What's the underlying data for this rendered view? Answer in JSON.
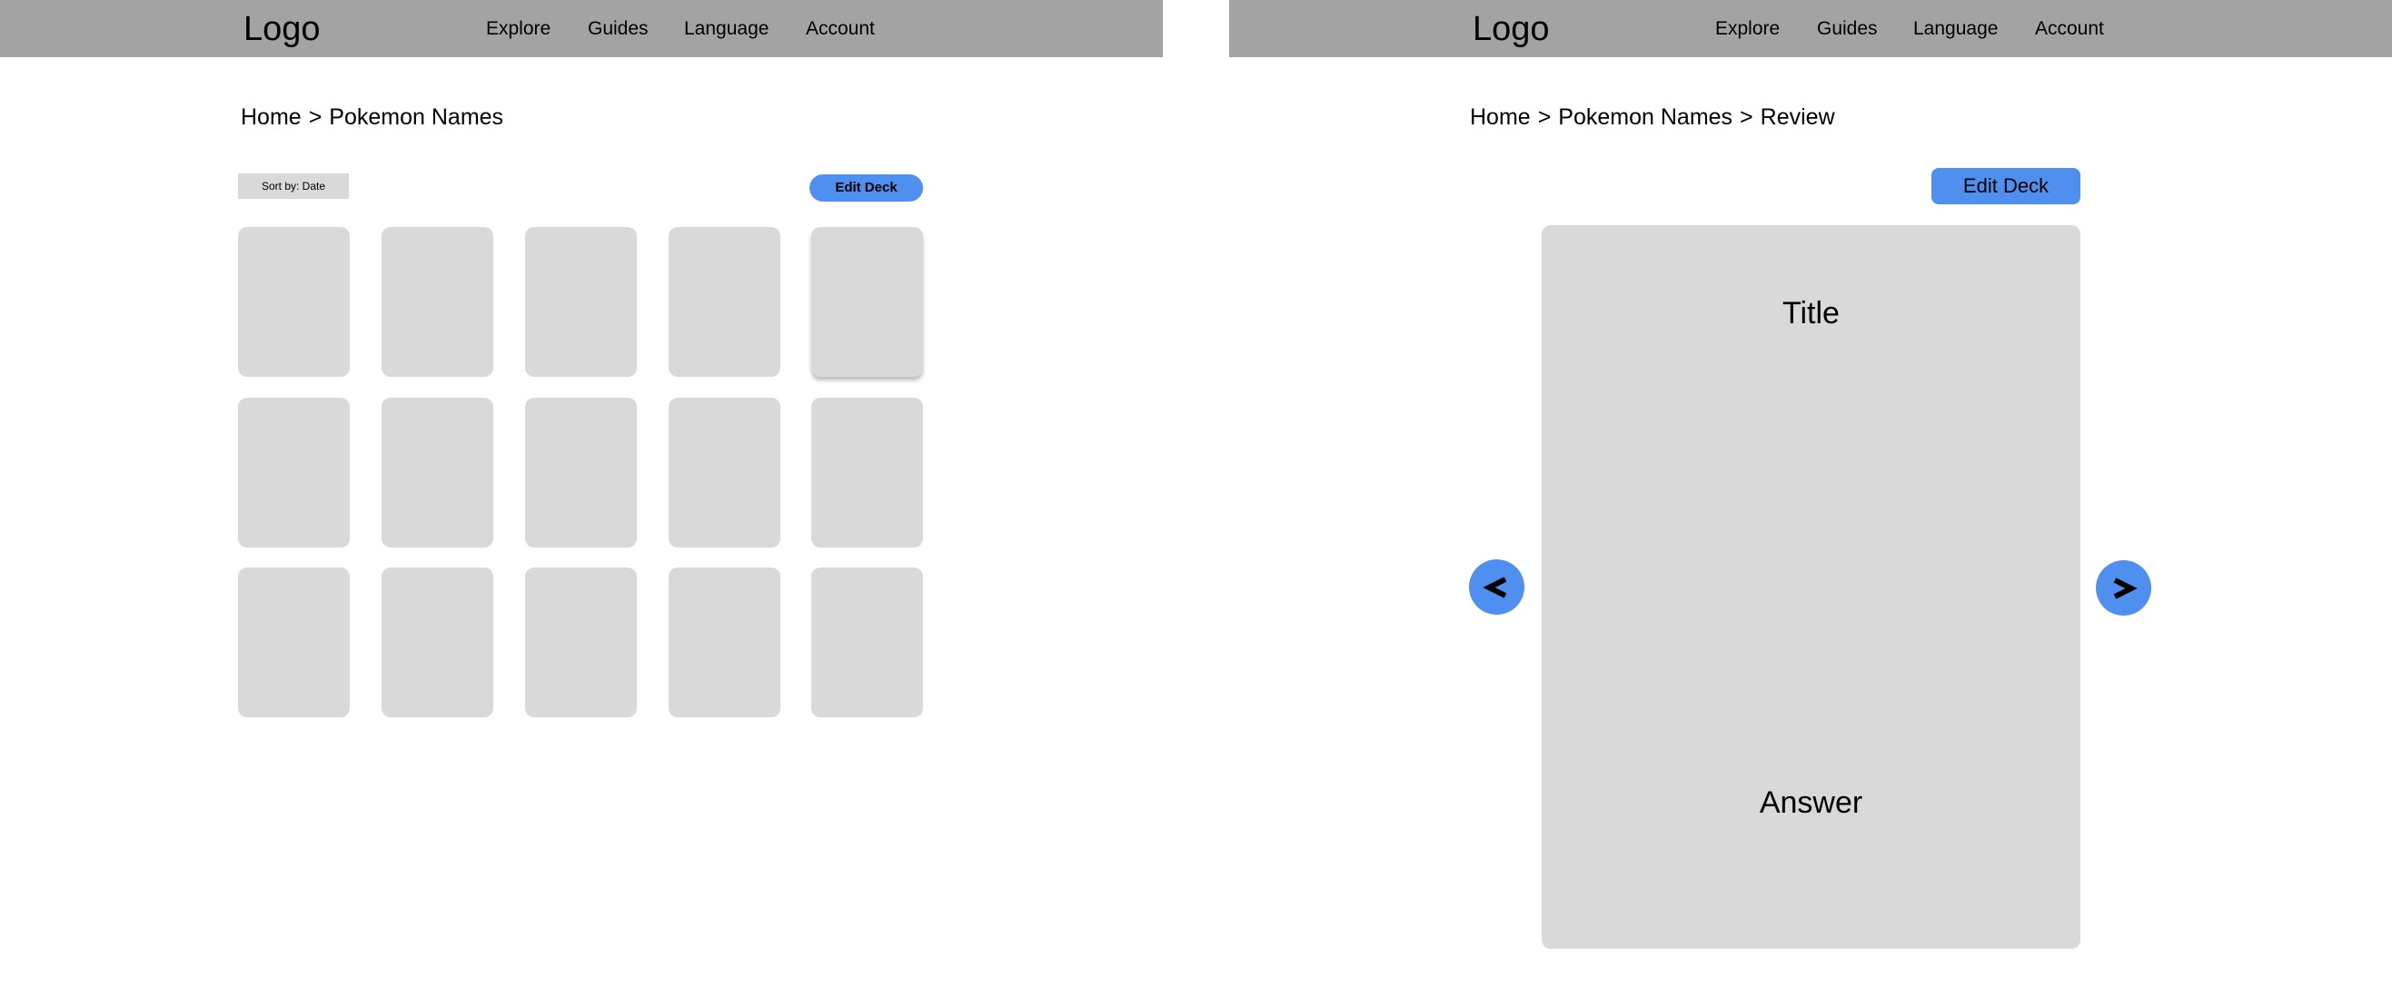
{
  "colors": {
    "topbar": "#a3a3a3",
    "card": "#d9d9d9",
    "accent": "#4f8ff0"
  },
  "left_screen": {
    "header": {
      "logo": "Logo",
      "nav": [
        "Explore",
        "Guides",
        "Language",
        "Account"
      ]
    },
    "breadcrumb": [
      "Home",
      "Pokemon Names"
    ],
    "breadcrumb_separator": ">",
    "toolbar": {
      "sort_label": "Sort by: Date",
      "edit_label": "Edit Deck"
    },
    "card_grid": {
      "rows": 3,
      "columns": 5
    }
  },
  "right_screen": {
    "header": {
      "logo": "Logo",
      "nav": [
        "Explore",
        "Guides",
        "Language",
        "Account"
      ]
    },
    "breadcrumb": [
      "Home",
      "Pokemon Names",
      "Review"
    ],
    "breadcrumb_separator": ">",
    "edit_label": "Edit Deck",
    "flashcard": {
      "title": "Title",
      "answer": "Answer"
    },
    "prev_icon": "chevron-left-icon",
    "next_icon": "chevron-right-icon"
  }
}
